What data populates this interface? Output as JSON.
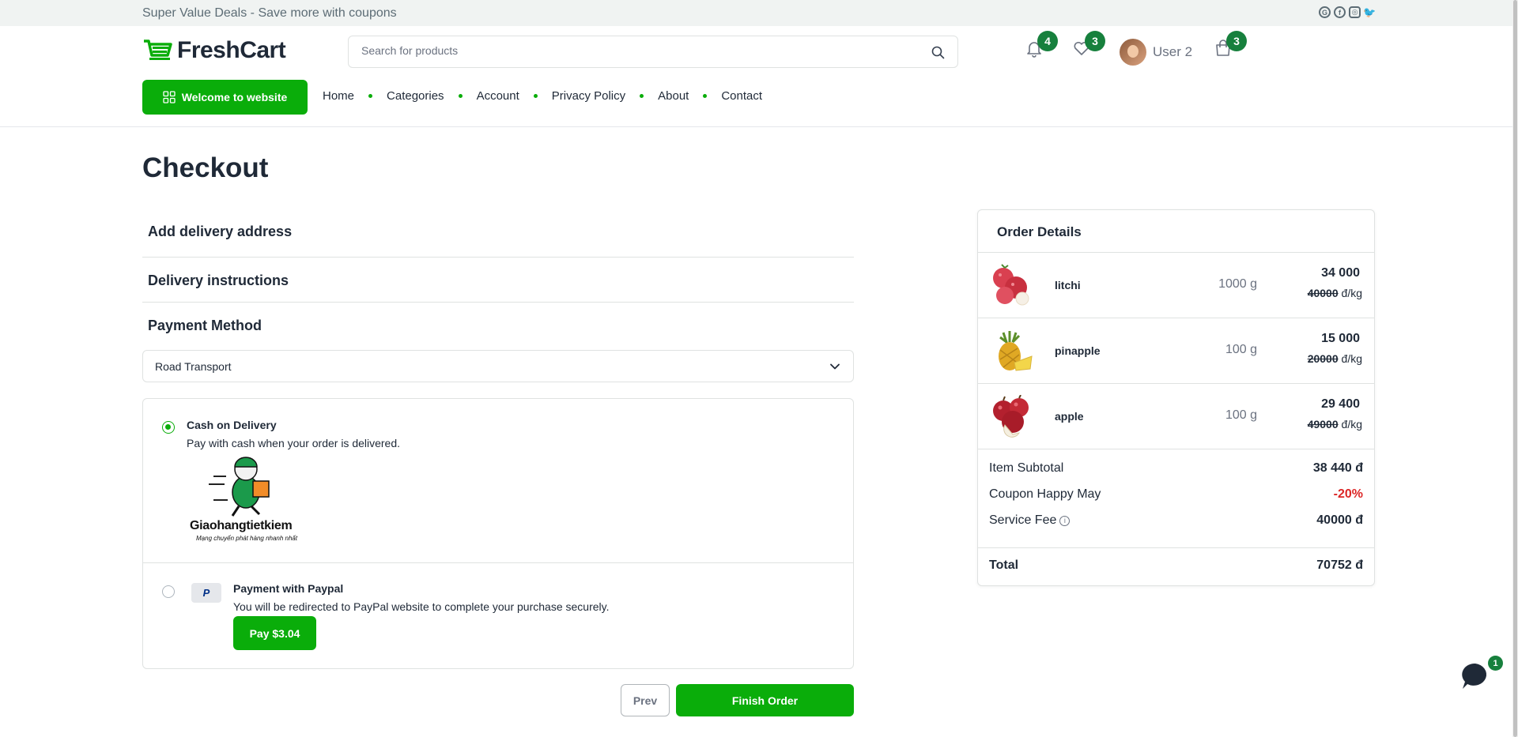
{
  "topbar": {
    "promo": "Super Value Deals - Save more with coupons",
    "socials": [
      "google-icon",
      "facebook-icon",
      "instagram-icon",
      "twitter-icon"
    ]
  },
  "header": {
    "logo_text": "FreshCart",
    "search_placeholder": "Search for products",
    "notifications_count": "4",
    "wishlist_count": "3",
    "user_name": "User 2",
    "cart_count": "3",
    "welcome_label": "Welcome to website",
    "nav": [
      "Home",
      "Categories",
      "Account",
      "Privacy Policy",
      "About",
      "Contact"
    ]
  },
  "checkout": {
    "title": "Checkout",
    "delivery_address": "Add delivery address",
    "delivery_instructions": "Delivery instructions",
    "payment_method": "Payment Method",
    "shipping_selected": "Road Transport",
    "payments": [
      {
        "title": "Cash on Delivery",
        "desc": "Pay with cash when your order is delivered.",
        "selected": true,
        "logo_brand": "Giaohangtietkiem",
        "logo_slogan": "Mạng chuyển phát hàng nhanh nhất"
      },
      {
        "title": "Payment with Paypal",
        "desc": "You will be redirected to PayPal website to complete your purchase securely.",
        "selected": false,
        "icon_text": "P",
        "button": "Pay $3.04"
      }
    ],
    "prev": "Prev",
    "finish": "Finish Order"
  },
  "order": {
    "title": "Order Details",
    "items": [
      {
        "name": "litchi",
        "qty": "1000 g",
        "price": "34 000",
        "old_price": "40000",
        "unit": "đ/kg",
        "image": "litchi-image"
      },
      {
        "name": "pinapple",
        "qty": "100 g",
        "price": "15 000",
        "old_price": "20000",
        "unit": "đ/kg",
        "image": "pineapple-image"
      },
      {
        "name": "apple",
        "qty": "100 g",
        "price": "29 400",
        "old_price": "49000",
        "unit": "đ/kg",
        "image": "apple-image"
      }
    ],
    "subtotal_label": "Item Subtotal",
    "subtotal": "38 440 đ",
    "coupon_label": "Coupon Happy May",
    "coupon": "-20%",
    "fee_label": "Service Fee",
    "fee": "40000 đ",
    "total_label": "Total",
    "total": "70752 đ"
  },
  "chat": {
    "count": "1"
  },
  "colors": {
    "brand": "#0aad0a",
    "badge": "#17803d",
    "discount": "#dc2626"
  }
}
